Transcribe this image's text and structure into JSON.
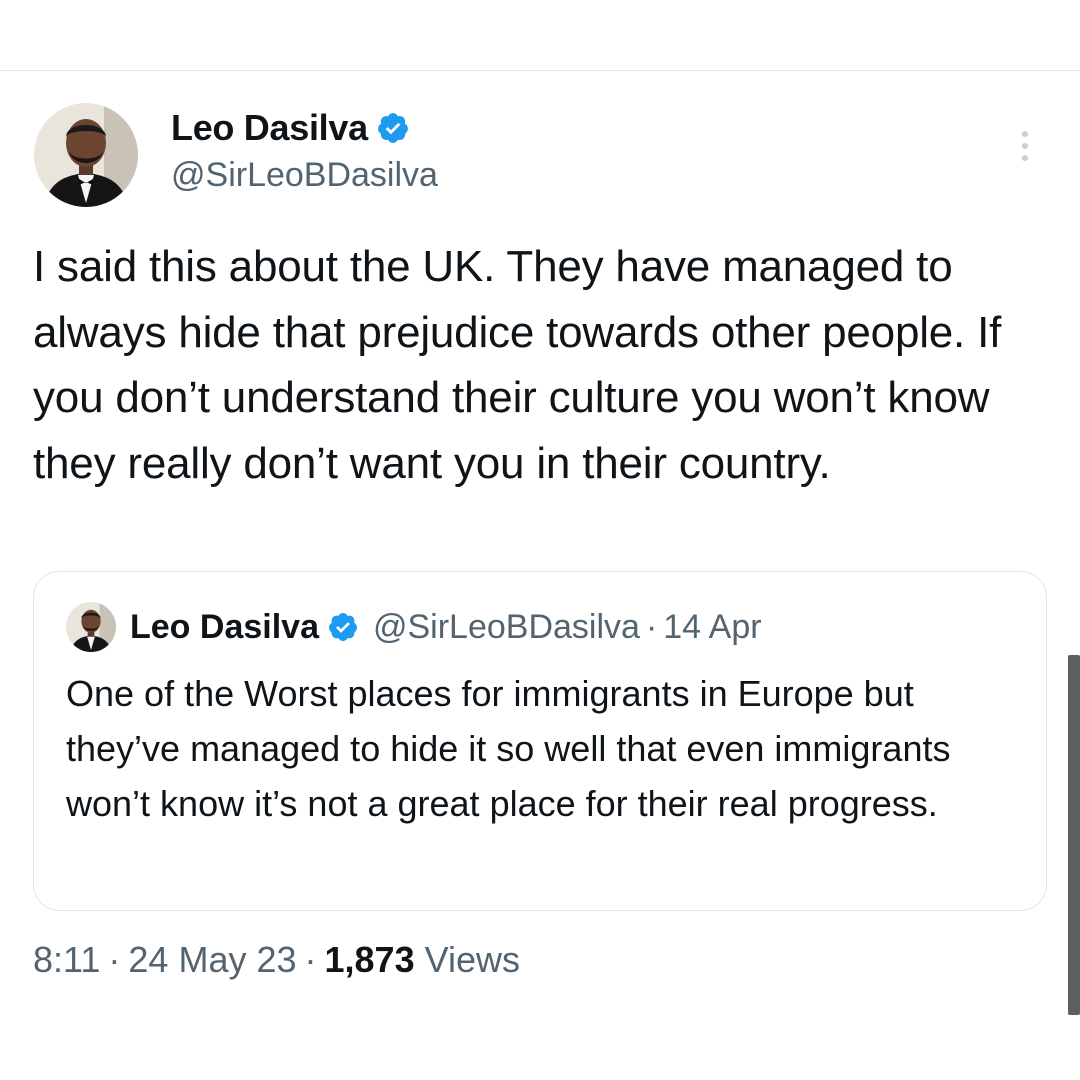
{
  "tweet": {
    "author": {
      "name": "Leo Dasilva",
      "handle": "@SirLeoBDasilva"
    },
    "text": "I said this about the UK. They have managed to always hide that prejudice towards other people. If you don’t understand their culture you won’t know they really don’t want you in their country.",
    "quoted": {
      "name": "Leo Dasilva",
      "handle": "@SirLeoBDasilva",
      "separator": "·",
      "date": "14 Apr",
      "text": "One of the Worst places for immigrants in Europe but they’ve managed to hide it so well that even immigrants won’t know it’s not a great place for their real progress."
    },
    "meta": {
      "time": "8:11",
      "separator": "·",
      "date": "24 May 23",
      "views_count": "1,873",
      "views_label": "Views"
    }
  },
  "icons": {
    "verified": "verified-badge-icon",
    "more": "more-vertical-icon"
  },
  "colors": {
    "verified_blue": "#1d9bf0",
    "text_primary": "#0f1419",
    "text_secondary": "#536471",
    "border": "#e3e6e8"
  }
}
